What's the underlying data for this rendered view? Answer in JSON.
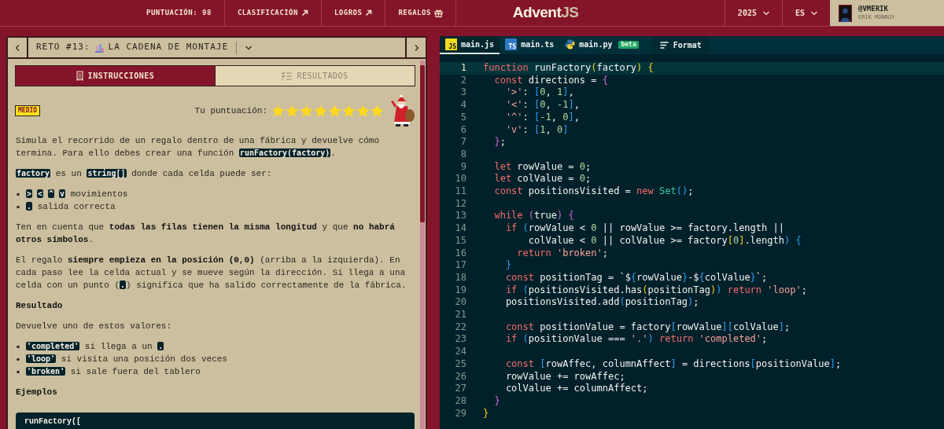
{
  "header": {
    "score": {
      "label": "PUNTUACIÓN:",
      "value": "98"
    },
    "links": [
      {
        "label": "CLASIFICACIÓN",
        "kind": "external"
      },
      {
        "label": "LOGROS",
        "kind": "external"
      },
      {
        "label": "REGALOS",
        "kind": "gift"
      }
    ],
    "logo": {
      "main": "Advent",
      "accent": "JS"
    },
    "selectors": [
      {
        "label": "2025"
      },
      {
        "label": "ES"
      }
    ],
    "user": {
      "handle": "@VMERIK",
      "name": "ERIK MONROY"
    }
  },
  "challenge": {
    "prefix": "RETO #13:",
    "name": "LA CADENA DE MONTAJE",
    "tabs": [
      {
        "label": "INSTRUCCIONES",
        "kind": "notes",
        "selected": true
      },
      {
        "label": "RESULTADOS",
        "kind": "checklist",
        "selected": false
      }
    ],
    "difficulty": "MEDIO",
    "score_label": "Tu puntuación:",
    "stars": 8,
    "blocks": [
      {
        "kind": "paragraph",
        "parts": [
          {
            "kind": "text",
            "text": "Simula el recorrido de un regalo dentro de una fábrica y devuelve cómo termina. Para ello debes crear una función "
          },
          {
            "kind": "code",
            "text": "runFactory(factory)"
          },
          {
            "kind": "text",
            "text": "."
          }
        ]
      },
      {
        "kind": "paragraph",
        "parts": [
          {
            "kind": "code",
            "text": "factory"
          },
          {
            "kind": "text",
            "text": " es un "
          },
          {
            "kind": "code",
            "text": "string[]"
          },
          {
            "kind": "text",
            "text": " donde cada celda puede ser:"
          }
        ]
      },
      {
        "kind": "list",
        "items": [
          [
            {
              "kind": "code",
              "text": ">"
            },
            {
              "kind": "code",
              "text": "<"
            },
            {
              "kind": "code",
              "text": "^"
            },
            {
              "kind": "code",
              "text": "v"
            },
            {
              "kind": "text",
              "text": " movimientos"
            }
          ],
          [
            {
              "kind": "code",
              "text": "."
            },
            {
              "kind": "text",
              "text": " salida correcta"
            }
          ]
        ]
      },
      {
        "kind": "paragraph",
        "parts": [
          {
            "kind": "text",
            "text": "Ten en cuenta que **todas las filas tienen la misma longitud** y que **no habrá otros símbolos**."
          }
        ]
      },
      {
        "kind": "paragraph",
        "parts": [
          {
            "kind": "text",
            "text": "El regalo **siempre empieza en la posición (0,0)** (arriba a la izquierda). En cada paso lee la celda actual y se mueve según la dirección. Si llega a una celda con un punto ("
          },
          {
            "kind": "code",
            "text": "."
          },
          {
            "kind": "text",
            "text": ") significa que ha salido correctamente de la fábrica."
          }
        ]
      },
      {
        "kind": "heading",
        "text": "Resultado"
      },
      {
        "kind": "paragraph",
        "parts": [
          {
            "kind": "text",
            "text": "Devuelve uno de estos valores:"
          }
        ]
      },
      {
        "kind": "list",
        "items": [
          [
            {
              "kind": "code",
              "text": "'completed'"
            },
            {
              "kind": "text",
              "text": " si llega a un "
            },
            {
              "kind": "code",
              "text": "."
            }
          ],
          [
            {
              "kind": "code",
              "text": "'loop'"
            },
            {
              "kind": "text",
              "text": " si visita una posición dos veces"
            }
          ],
          [
            {
              "kind": "code",
              "text": "'broken'"
            },
            {
              "kind": "text",
              "text": " si sale fuera del tablero"
            }
          ]
        ]
      },
      {
        "kind": "heading",
        "text": "Ejemplos"
      },
      {
        "kind": "code_block",
        "text": "runFactory(["
      }
    ]
  },
  "editor": {
    "tabs": [
      {
        "label": "main.js",
        "kind": "js",
        "icon_text": "JS",
        "selected": true
      },
      {
        "label": "main.ts",
        "kind": "ts",
        "icon_text": "TS",
        "selected": false
      },
      {
        "label": "main.py",
        "kind": "py",
        "badge": "beta",
        "selected": false
      }
    ],
    "format_button": "Format",
    "lines": [
      {
        "number": "1",
        "active": true,
        "tokens": [
          {
            "kind": "keyword",
            "text": "function"
          },
          {
            "kind": "plain",
            "text": " runFactory"
          },
          {
            "kind": "bracket1",
            "text": "("
          },
          {
            "kind": "plain",
            "text": "factory"
          },
          {
            "kind": "bracket1",
            "text": ")"
          },
          {
            "kind": "bracket1",
            "text": " {"
          }
        ]
      },
      {
        "number": "2",
        "active": false,
        "tokens": [
          {
            "kind": "keyword",
            "text": "  const"
          },
          {
            "kind": "plain",
            "text": " directions = "
          },
          {
            "kind": "bracket2",
            "text": "{"
          }
        ]
      },
      {
        "number": "3",
        "active": false,
        "tokens": [
          {
            "kind": "string",
            "text": "    '>'"
          },
          {
            "kind": "plain",
            "text": ": "
          },
          {
            "kind": "bracket3",
            "text": "["
          },
          {
            "kind": "number",
            "text": "0"
          },
          {
            "kind": "plain",
            "text": ", "
          },
          {
            "kind": "number",
            "text": "1"
          },
          {
            "kind": "bracket3",
            "text": "]"
          },
          {
            "kind": "plain",
            "text": ","
          }
        ]
      },
      {
        "number": "4",
        "active": false,
        "tokens": [
          {
            "kind": "string",
            "text": "    '<'"
          },
          {
            "kind": "plain",
            "text": ": "
          },
          {
            "kind": "bracket3",
            "text": "["
          },
          {
            "kind": "number",
            "text": "0"
          },
          {
            "kind": "plain",
            "text": ", "
          },
          {
            "kind": "number",
            "text": "-1"
          },
          {
            "kind": "bracket3",
            "text": "]"
          },
          {
            "kind": "plain",
            "text": ","
          }
        ]
      },
      {
        "number": "5",
        "active": false,
        "tokens": [
          {
            "kind": "string",
            "text": "    '^'"
          },
          {
            "kind": "plain",
            "text": ": "
          },
          {
            "kind": "bracket3",
            "text": "["
          },
          {
            "kind": "number",
            "text": "-1"
          },
          {
            "kind": "plain",
            "text": ", "
          },
          {
            "kind": "number",
            "text": "0"
          },
          {
            "kind": "bracket3",
            "text": "]"
          },
          {
            "kind": "plain",
            "text": ","
          }
        ]
      },
      {
        "number": "6",
        "active": false,
        "tokens": [
          {
            "kind": "string",
            "text": "    'v'"
          },
          {
            "kind": "plain",
            "text": ": "
          },
          {
            "kind": "bracket3",
            "text": "["
          },
          {
            "kind": "number",
            "text": "1"
          },
          {
            "kind": "plain",
            "text": ", "
          },
          {
            "kind": "number",
            "text": "0"
          },
          {
            "kind": "bracket3",
            "text": "]"
          }
        ]
      },
      {
        "number": "7",
        "active": false,
        "tokens": [
          {
            "kind": "bracket2",
            "text": "  }"
          },
          {
            "kind": "plain",
            "text": ";"
          }
        ]
      },
      {
        "number": "8",
        "active": false
      },
      {
        "number": "9",
        "active": false,
        "tokens": [
          {
            "kind": "keyword",
            "text": "  let"
          },
          {
            "kind": "plain",
            "text": " rowValue = "
          },
          {
            "kind": "number",
            "text": "0"
          },
          {
            "kind": "plain",
            "text": ";"
          }
        ]
      },
      {
        "number": "10",
        "active": false,
        "tokens": [
          {
            "kind": "keyword",
            "text": "  let"
          },
          {
            "kind": "plain",
            "text": " colValue = "
          },
          {
            "kind": "number",
            "text": "0"
          },
          {
            "kind": "plain",
            "text": ";"
          }
        ]
      },
      {
        "number": "11",
        "active": false,
        "tokens": [
          {
            "kind": "keyword",
            "text": "  const"
          },
          {
            "kind": "plain",
            "text": " positionsVisited = "
          },
          {
            "kind": "keyword",
            "text": "new"
          },
          {
            "kind": "type",
            "text": " Set"
          },
          {
            "kind": "bracket3",
            "text": "()"
          },
          {
            "kind": "plain",
            "text": ";"
          }
        ]
      },
      {
        "number": "12",
        "active": false
      },
      {
        "number": "13",
        "active": false,
        "tokens": [
          {
            "kind": "keyword",
            "text": "  while"
          },
          {
            "kind": "bracket2",
            "text": " ("
          },
          {
            "kind": "plain",
            "text": "true"
          },
          {
            "kind": "bracket2",
            "text": ")"
          },
          {
            "kind": "bracket2",
            "text": " {"
          }
        ]
      },
      {
        "number": "14",
        "active": false,
        "tokens": [
          {
            "kind": "keyword",
            "text": "    if"
          },
          {
            "kind": "bracket3",
            "text": " ("
          },
          {
            "kind": "plain",
            "text": "rowValue < "
          },
          {
            "kind": "number",
            "text": "0"
          },
          {
            "kind": "plain",
            "text": " || rowValue >= factory.length ||"
          }
        ]
      },
      {
        "number": "15",
        "active": false,
        "tokens": [
          {
            "kind": "plain",
            "text": "        colValue < "
          },
          {
            "kind": "number",
            "text": "0"
          },
          {
            "kind": "plain",
            "text": " || colValue >= factory"
          },
          {
            "kind": "bracket1",
            "text": "["
          },
          {
            "kind": "number",
            "text": "0"
          },
          {
            "kind": "bracket1",
            "text": "]"
          },
          {
            "kind": "plain",
            "text": ".length"
          },
          {
            "kind": "bracket3",
            "text": ")"
          },
          {
            "kind": "bracket3",
            "text": " {"
          }
        ]
      },
      {
        "number": "16",
        "active": false,
        "tokens": [
          {
            "kind": "keyword",
            "text": "      return"
          },
          {
            "kind": "string",
            "text": " 'broken'"
          },
          {
            "kind": "plain",
            "text": ";"
          }
        ]
      },
      {
        "number": "17",
        "active": false,
        "tokens": [
          {
            "kind": "bracket3",
            "text": "    }"
          }
        ]
      },
      {
        "number": "18",
        "active": false,
        "tokens": [
          {
            "kind": "keyword",
            "text": "    const"
          },
          {
            "kind": "plain",
            "text": " positionTag = `$"
          },
          {
            "kind": "bracket3",
            "text": "{"
          },
          {
            "kind": "plain",
            "text": "rowValue"
          },
          {
            "kind": "bracket3",
            "text": "}"
          },
          {
            "kind": "plain",
            "text": "-$"
          },
          {
            "kind": "bracket3",
            "text": "{"
          },
          {
            "kind": "plain",
            "text": "colValue"
          },
          {
            "kind": "bracket3",
            "text": "}"
          },
          {
            "kind": "plain",
            "text": "`;"
          }
        ]
      },
      {
        "number": "19",
        "active": false,
        "tokens": [
          {
            "kind": "keyword",
            "text": "    if"
          },
          {
            "kind": "bracket3",
            "text": " ("
          },
          {
            "kind": "plain",
            "text": "positionsVisited.has"
          },
          {
            "kind": "bracket1",
            "text": "("
          },
          {
            "kind": "plain",
            "text": "positionTag"
          },
          {
            "kind": "bracket1",
            "text": ")"
          },
          {
            "kind": "bracket3",
            "text": ")"
          },
          {
            "kind": "keyword",
            "text": " return"
          },
          {
            "kind": "string",
            "text": " 'loop'"
          },
          {
            "kind": "plain",
            "text": ";"
          }
        ]
      },
      {
        "number": "20",
        "active": false,
        "tokens": [
          {
            "kind": "plain",
            "text": "    positionsVisited.add"
          },
          {
            "kind": "bracket3",
            "text": "("
          },
          {
            "kind": "plain",
            "text": "positionTag"
          },
          {
            "kind": "bracket3",
            "text": ")"
          },
          {
            "kind": "plain",
            "text": ";"
          }
        ]
      },
      {
        "number": "21",
        "active": false
      },
      {
        "number": "22",
        "active": false,
        "tokens": [
          {
            "kind": "keyword",
            "text": "    const"
          },
          {
            "kind": "plain",
            "text": " positionValue = factory"
          },
          {
            "kind": "bracket3",
            "text": "["
          },
          {
            "kind": "plain",
            "text": "rowValue"
          },
          {
            "kind": "bracket3",
            "text": "]["
          },
          {
            "kind": "plain",
            "text": "colValue"
          },
          {
            "kind": "bracket3",
            "text": "]"
          },
          {
            "kind": "plain",
            "text": ";"
          }
        ]
      },
      {
        "number": "23",
        "active": false,
        "tokens": [
          {
            "kind": "keyword",
            "text": "    if"
          },
          {
            "kind": "bracket3",
            "text": " ("
          },
          {
            "kind": "plain",
            "text": "positionValue === "
          },
          {
            "kind": "string",
            "text": "'.'"
          },
          {
            "kind": "bracket3",
            "text": ")"
          },
          {
            "kind": "keyword",
            "text": " return"
          },
          {
            "kind": "string",
            "text": " 'completed'"
          },
          {
            "kind": "plain",
            "text": ";"
          }
        ]
      },
      {
        "number": "24",
        "active": false
      },
      {
        "number": "25",
        "active": false,
        "tokens": [
          {
            "kind": "keyword",
            "text": "    const"
          },
          {
            "kind": "bracket3",
            "text": " ["
          },
          {
            "kind": "plain",
            "text": "rowAffec, columnAffect"
          },
          {
            "kind": "bracket3",
            "text": "]"
          },
          {
            "kind": "plain",
            "text": " = directions"
          },
          {
            "kind": "bracket3",
            "text": "["
          },
          {
            "kind": "plain",
            "text": "positionValue"
          },
          {
            "kind": "bracket3",
            "text": "]"
          },
          {
            "kind": "plain",
            "text": ";"
          }
        ]
      },
      {
        "number": "26",
        "active": false,
        "tokens": [
          {
            "kind": "plain",
            "text": "    rowValue += rowAffec;"
          }
        ]
      },
      {
        "number": "27",
        "active": false,
        "tokens": [
          {
            "kind": "plain",
            "text": "    colValue += columnAffect;"
          }
        ]
      },
      {
        "number": "28",
        "active": false,
        "tokens": [
          {
            "kind": "bracket2",
            "text": "  }"
          }
        ]
      },
      {
        "number": "29",
        "active": false,
        "tokens": [
          {
            "kind": "bracket1",
            "text": "}"
          }
        ]
      }
    ]
  }
}
